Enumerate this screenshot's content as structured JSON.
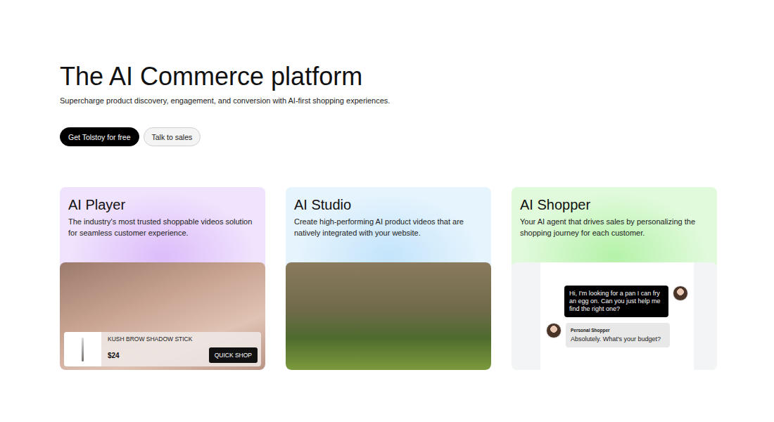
{
  "hero": {
    "title": "The AI Commerce platform",
    "subtitle": "Supercharge product discovery, engagement, and conversion with AI-first shopping experiences.",
    "buttons": [
      {
        "label": "Get Tolstoy for free",
        "kind": "primary"
      },
      {
        "label": "Talk to sales",
        "kind": "secondary"
      }
    ]
  },
  "cards": [
    {
      "title": "AI Player",
      "description": "The industry's most trusted shoppable videos solution for seamless customer experience.",
      "color": "#dcbcfa",
      "kind": "player",
      "product": {
        "name": "KUSH BROW SHADOW STICK",
        "price": "$24",
        "action": "QUICK SHOP"
      }
    },
    {
      "title": "AI Studio",
      "description": "Create high-performing AI product videos that are natively integrated with your website.",
      "color": "#c3e4fb",
      "kind": "studio"
    },
    {
      "title": "AI Shopper",
      "description": "Your AI agent that drives sales by personalizing the shopping journey for each customer.",
      "color": "#b5f2a9",
      "kind": "shopper",
      "messages": [
        {
          "kind": "customer",
          "text": "Hi, I'm looking for a pan I can fry an egg on. Can you just help me find the right one?"
        },
        {
          "kind": "agent",
          "name": "Personal Shopper",
          "text": "Absolutely. What's your budget?"
        }
      ]
    }
  ]
}
